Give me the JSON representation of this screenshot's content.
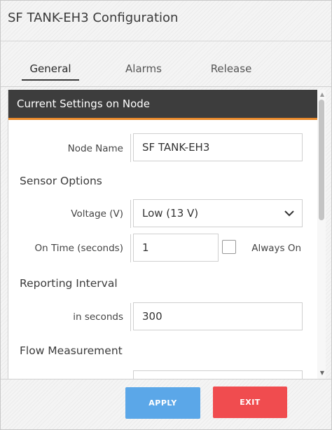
{
  "dialog": {
    "title": "SF TANK-EH3 Configuration"
  },
  "tabs": [
    {
      "label": "General",
      "active": true
    },
    {
      "label": "Alarms",
      "active": false
    },
    {
      "label": "Release",
      "active": false
    }
  ],
  "panel": {
    "header": "Current Settings on Node",
    "node_name": {
      "label": "Node Name",
      "value": "SF TANK-EH3"
    },
    "sensor_options": {
      "heading": "Sensor Options",
      "voltage": {
        "label": "Voltage (V)",
        "selected": "Low (13 V)"
      },
      "on_time": {
        "label": "On Time (seconds)",
        "value": "1"
      },
      "always_on": {
        "label": "Always On",
        "checked": false
      }
    },
    "reporting_interval": {
      "heading": "Reporting Interval",
      "seconds": {
        "label": "in seconds",
        "value": "300"
      }
    },
    "flow_measurement": {
      "heading": "Flow Measurement"
    }
  },
  "buttons": {
    "apply": "APPLY",
    "exit": "EXIT"
  },
  "colors": {
    "section_header_bg": "#3d3d3d",
    "section_header_accent": "#e8892b",
    "apply_button": "#5ba7e8",
    "exit_button": "#f04c4f"
  },
  "icons": {
    "select_caret": "chevron-down-icon",
    "scroll_up": "scroll-up-arrow-icon",
    "scroll_down": "scroll-down-arrow-icon"
  }
}
